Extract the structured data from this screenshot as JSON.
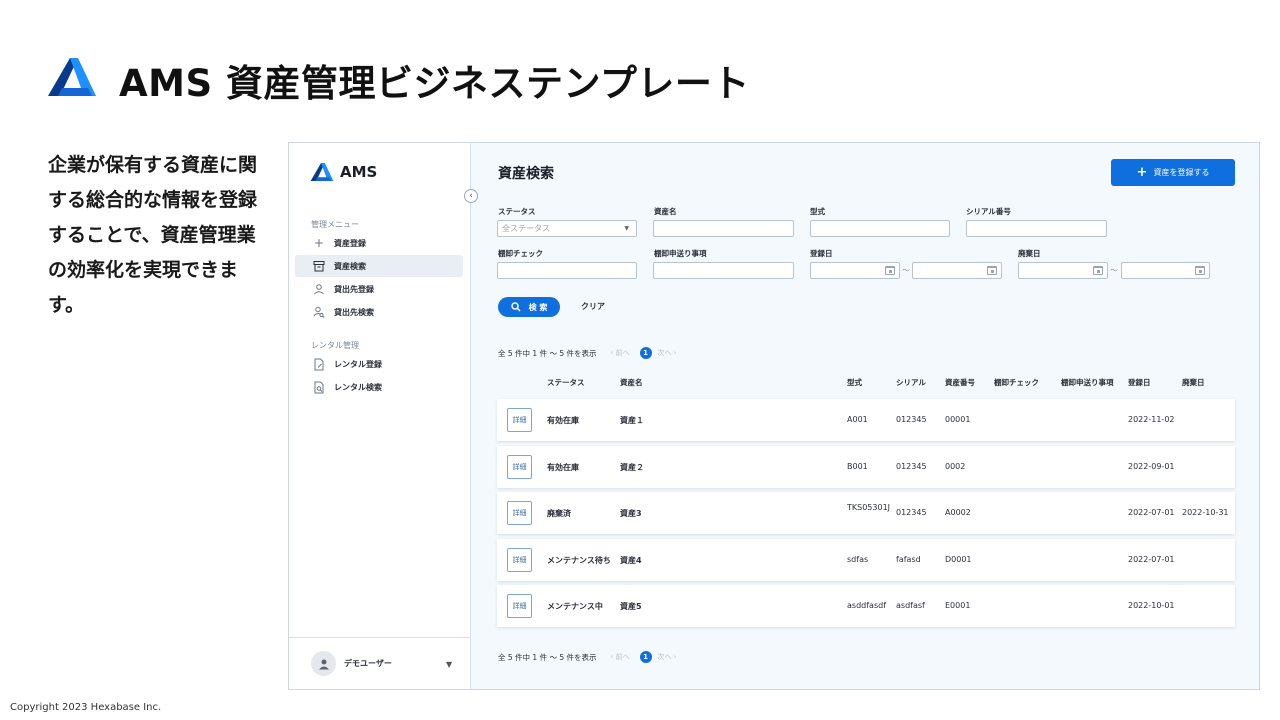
{
  "slide": {
    "title": "AMS 資産管理ビジネステンプレート",
    "description": "企業が保有する資産に関する総合的な情報を登録することで、資産管理業の効率化を実現できます。",
    "copyright": "Copyright 2023 Hexabase Inc."
  },
  "colors": {
    "brand_blue": "#0f6fde",
    "sidebar_active": "#e9eef4"
  },
  "app": {
    "brand": "AMS",
    "sidebar": {
      "section1": "管理メニュー",
      "items1": [
        {
          "label": "資産登録",
          "icon": "plus-icon"
        },
        {
          "label": "資産検索",
          "icon": "archive-icon",
          "active": true
        },
        {
          "label": "貸出先登録",
          "icon": "person-icon"
        },
        {
          "label": "貸出先検索",
          "icon": "person-search-icon"
        }
      ],
      "section2": "レンタル管理",
      "items2": [
        {
          "label": "レンタル登録",
          "icon": "document-edit-icon"
        },
        {
          "label": "レンタル検索",
          "icon": "document-search-icon"
        }
      ],
      "user": "デモユーザー"
    },
    "page_title": "資産検索",
    "register_button": "資産を登録する",
    "filters": {
      "status_label": "ステータス",
      "status_value": "全ステータス",
      "asset_name_label": "資産名",
      "model_label": "型式",
      "serial_label": "シリアル番号",
      "inventory_check_label": "棚卸チェック",
      "inventory_note_label": "棚卸申送り事項",
      "reg_date_label": "登録日",
      "disposal_date_label": "廃棄日",
      "range_sep": "〜"
    },
    "search_button": "検 索",
    "clear_button": "クリア",
    "pagination": {
      "summary": "全 5 件中 1 件 〜 5 件を表示",
      "prev": "前へ",
      "current": "1",
      "next": "次へ"
    },
    "table": {
      "headers": [
        "ステータス",
        "資産名",
        "型式",
        "シリアル",
        "資産番号",
        "棚卸チェック",
        "棚卸申送り事項",
        "登録日",
        "廃棄日"
      ],
      "detail_label": "詳細",
      "rows": [
        {
          "status": "有効在庫",
          "name": "資産１",
          "model": "A001",
          "serial": "012345",
          "asset_no": "00001",
          "check": "",
          "note": "",
          "reg_date": "2022-11-02",
          "disposal": ""
        },
        {
          "status": "有効在庫",
          "name": "資産２",
          "model": "B001",
          "serial": "012345",
          "asset_no": "0002",
          "check": "",
          "note": "",
          "reg_date": "2022-09-01",
          "disposal": ""
        },
        {
          "status": "廃棄済",
          "name": "資産3",
          "model": "TKS05301J",
          "serial": "012345",
          "asset_no": "A0002",
          "check": "",
          "note": "",
          "reg_date": "2022-07-01",
          "disposal": "2022-10-31"
        },
        {
          "status": "メンテナンス待ち",
          "name": "資産4",
          "model": "sdfas",
          "serial": "fafasd",
          "asset_no": "D0001",
          "check": "",
          "note": "",
          "reg_date": "2022-07-01",
          "disposal": ""
        },
        {
          "status": "メンテナンス中",
          "name": "資産5",
          "model": "asddfasdf",
          "serial": "asdfasf",
          "asset_no": "E0001",
          "check": "",
          "note": "",
          "reg_date": "2022-10-01",
          "disposal": ""
        }
      ]
    }
  }
}
